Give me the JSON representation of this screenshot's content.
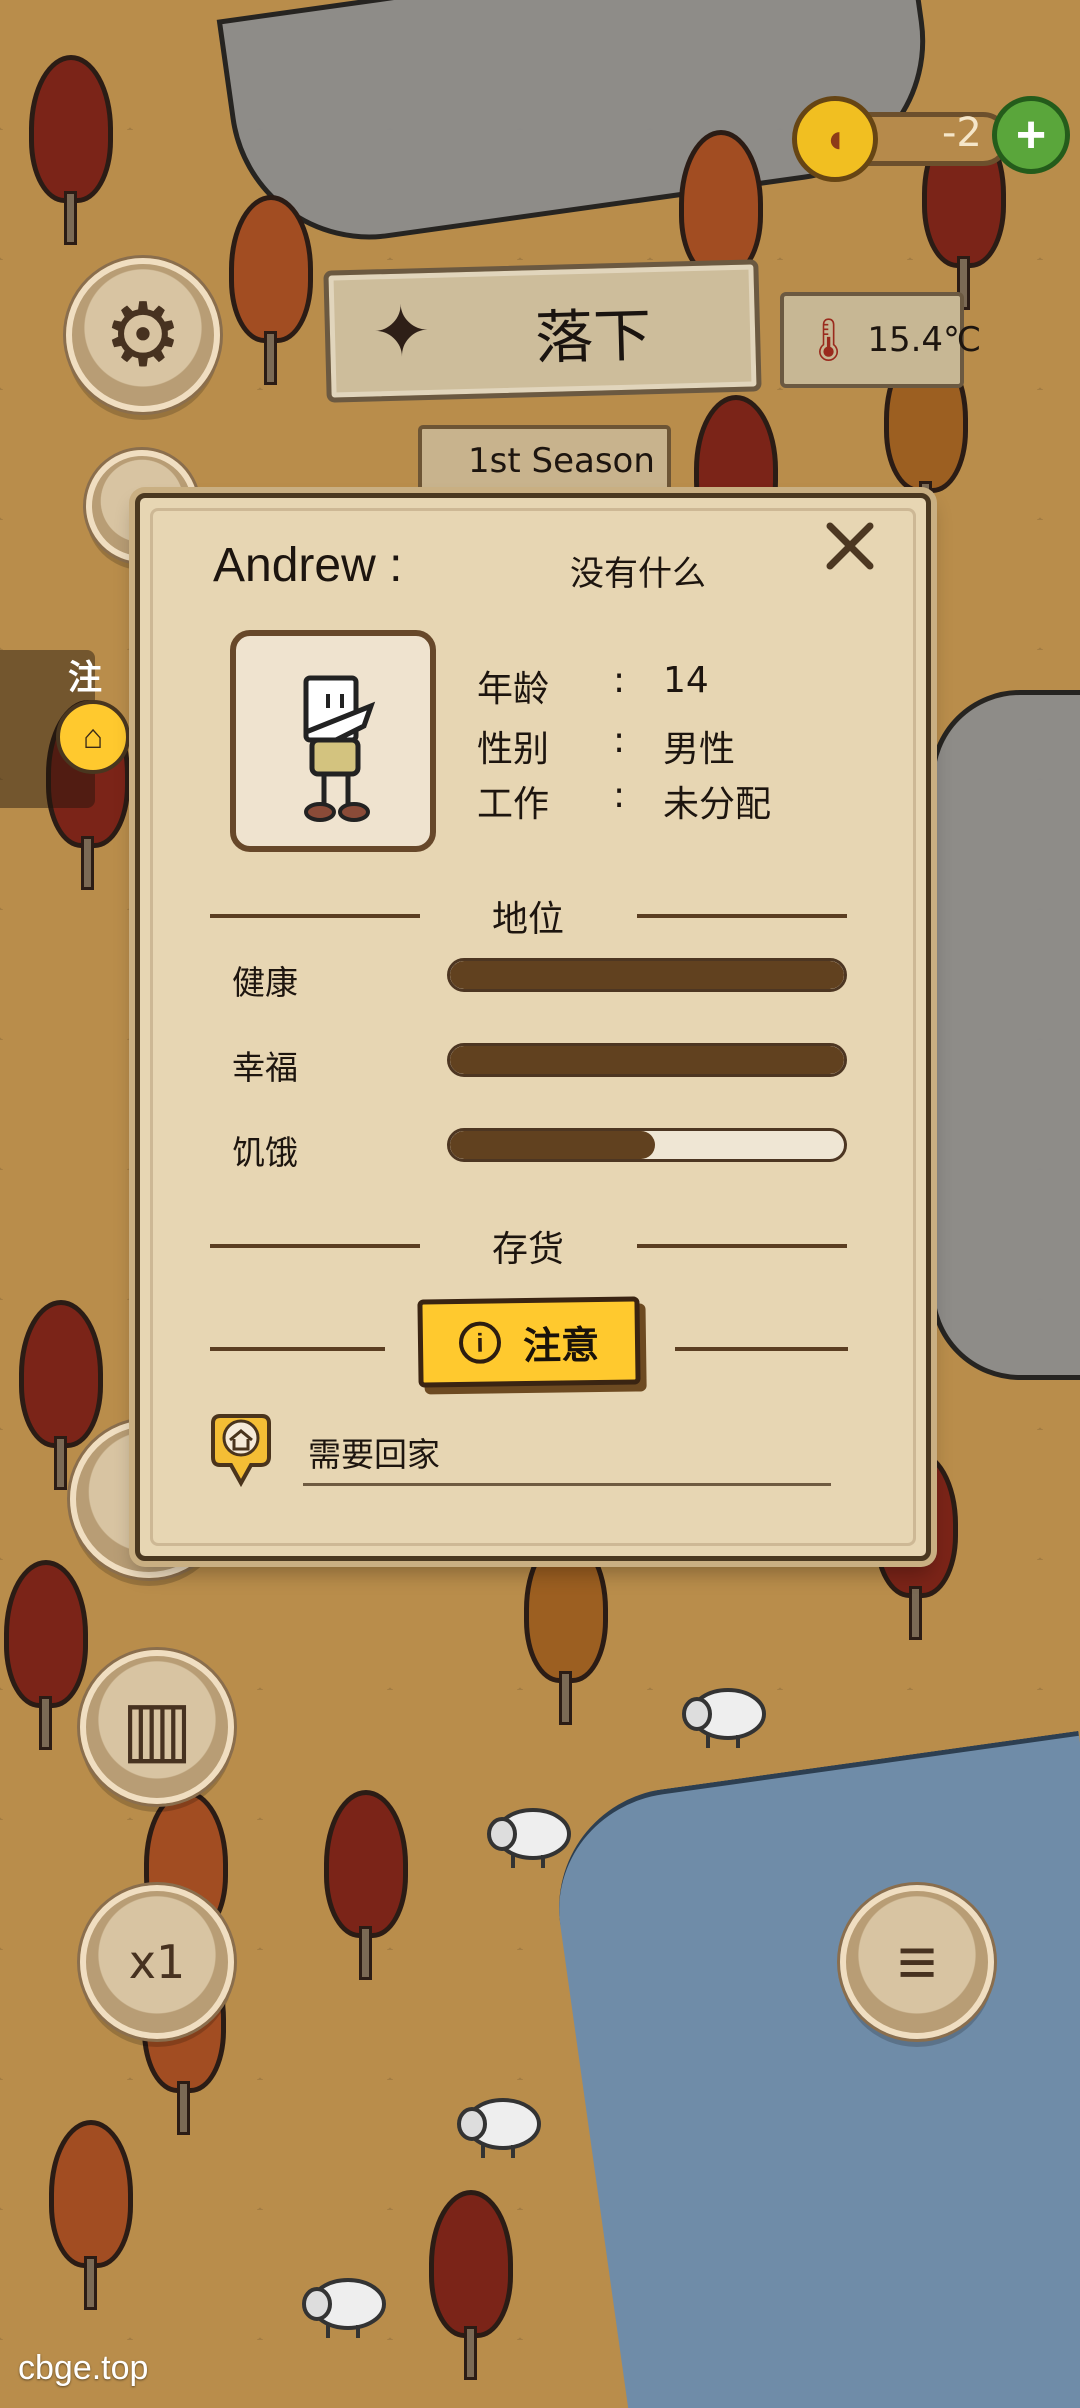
{
  "header": {
    "resource_value": "-2",
    "season_name": "落下",
    "season_label": "1st Season",
    "temperature": "15.4℃"
  },
  "left_controls": {
    "notice_label": "注意",
    "speed_label": "x1"
  },
  "dialog": {
    "name": "Andrew :",
    "status_text": "没有什么",
    "info": {
      "age_label": "年龄",
      "age_value": "14",
      "gender_label": "性别",
      "gender_value": "男性",
      "job_label": "工作",
      "job_value": "未分配"
    },
    "status_section_label": "地位",
    "stats": [
      {
        "label": "健康",
        "value": 1.0
      },
      {
        "label": "幸福",
        "value": 1.0
      },
      {
        "label": "饥饿",
        "value": 0.52
      }
    ],
    "inventory_section_label": "存货",
    "notice_button_label": "注意",
    "need_text": "需要回家"
  },
  "watermark": "cbge.top",
  "colors": {
    "panel": "#e7d6b3",
    "bar_fill": "#61411f",
    "accent_yellow": "#ffc92e",
    "map_base": "#b98d4b"
  }
}
